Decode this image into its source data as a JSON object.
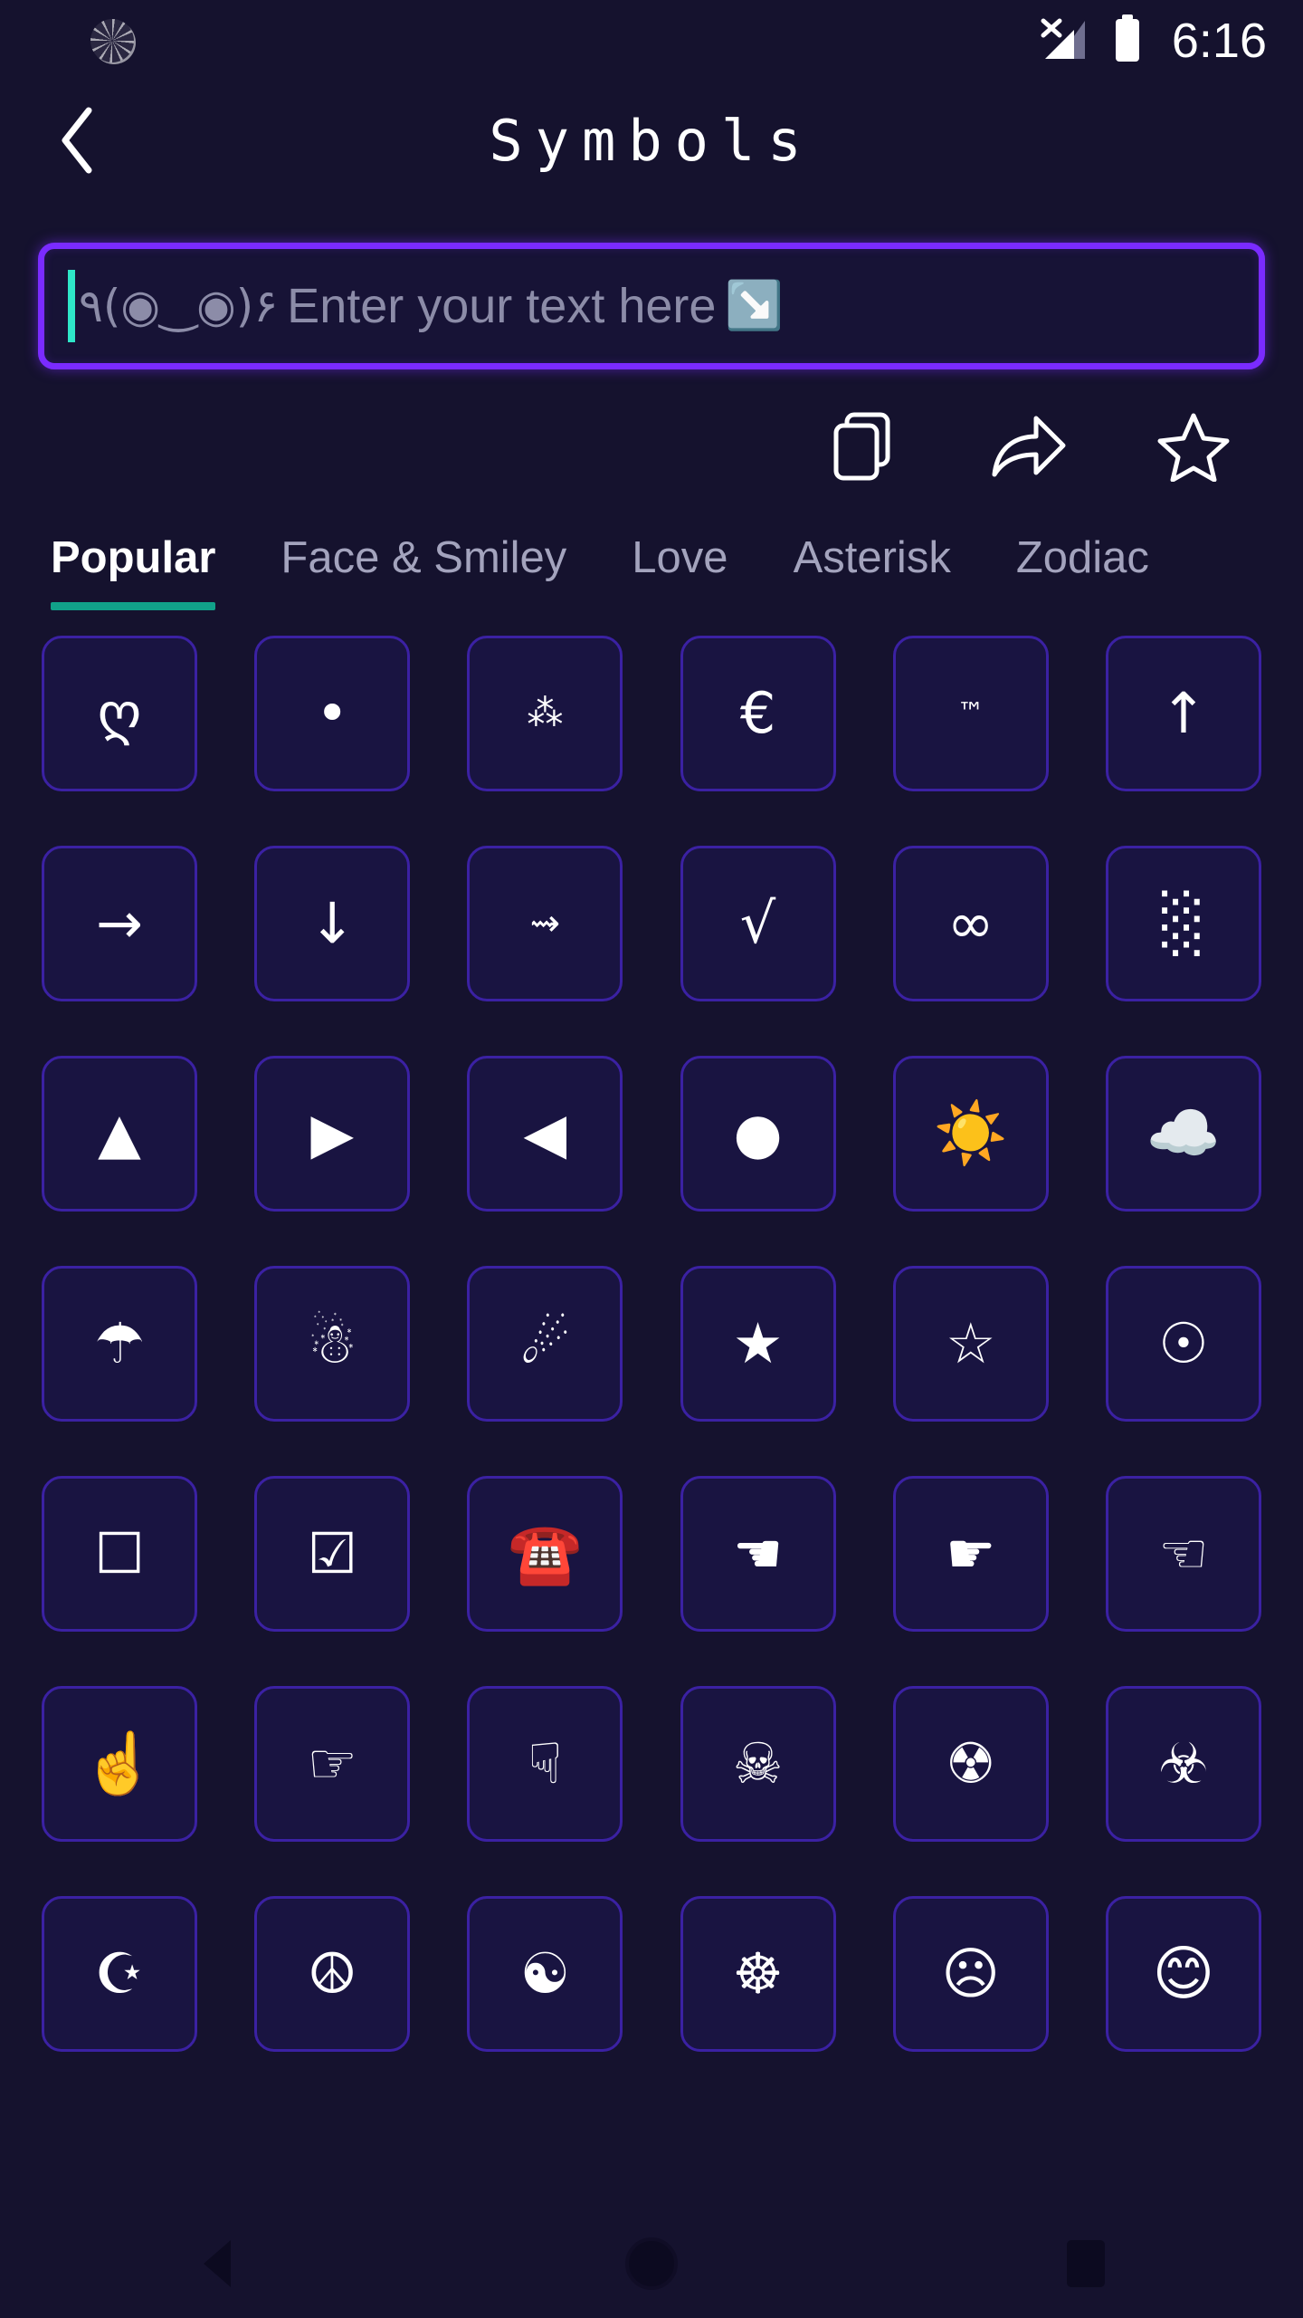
{
  "status_bar": {
    "time": "6:16",
    "icons": [
      "loading-spinner-icon",
      "signal-no-sim-icon",
      "battery-full-icon"
    ]
  },
  "header": {
    "back_label": "‹",
    "title": "Symbols"
  },
  "search": {
    "placeholder_kaomoji": "٩(◉‿◉)۶",
    "placeholder_text": "Enter your text here",
    "placeholder_emoji": "↘️",
    "value": ""
  },
  "actions": [
    {
      "name": "copy-button",
      "label": "Copy"
    },
    {
      "name": "share-button",
      "label": "Share"
    },
    {
      "name": "favorite-button",
      "label": "Favorite"
    }
  ],
  "tabs": {
    "active_index": 0,
    "items": [
      {
        "label": "Popular"
      },
      {
        "label": "Face & Smiley"
      },
      {
        "label": "Love"
      },
      {
        "label": "Asterisk"
      },
      {
        "label": "Zodiac"
      }
    ]
  },
  "grid": {
    "columns": 6,
    "cells": [
      {
        "char": "ღ",
        "name": "georgian-heart-symbol",
        "size": "normal"
      },
      {
        "char": "•",
        "name": "bullet-symbol",
        "size": "normal"
      },
      {
        "char": "⁂",
        "name": "asterism-symbol",
        "size": "small"
      },
      {
        "char": "€",
        "name": "euro-sign-symbol",
        "size": "normal"
      },
      {
        "char": "™",
        "name": "trademark-symbol",
        "size": "tiny"
      },
      {
        "char": "↑",
        "name": "up-arrow-symbol",
        "size": "normal"
      },
      {
        "char": "→",
        "name": "right-arrow-symbol",
        "size": "normal"
      },
      {
        "char": "↓",
        "name": "down-arrow-symbol",
        "size": "normal"
      },
      {
        "char": "⇝",
        "name": "squiggly-right-arrow-symbol",
        "size": "small"
      },
      {
        "char": "√",
        "name": "square-root-symbol",
        "size": "normal"
      },
      {
        "char": "∞",
        "name": "infinity-symbol",
        "size": "normal"
      },
      {
        "char": "░",
        "name": "light-shade-block-symbol",
        "size": "normal"
      },
      {
        "char": "▲",
        "name": "up-triangle-symbol",
        "size": "normal"
      },
      {
        "char": "▶",
        "name": "right-triangle-symbol",
        "size": "normal"
      },
      {
        "char": "◀",
        "name": "left-triangle-symbol",
        "size": "normal"
      },
      {
        "char": "●",
        "name": "filled-circle-symbol",
        "size": "normal"
      },
      {
        "char": "☀️",
        "name": "sun-emoji",
        "size": "emoji"
      },
      {
        "char": "☁️",
        "name": "cloud-emoji",
        "size": "emoji"
      },
      {
        "char": "☂",
        "name": "umbrella-symbol",
        "size": "normal"
      },
      {
        "char": "☃",
        "name": "snowman-symbol",
        "size": "normal"
      },
      {
        "char": "☄",
        "name": "comet-symbol",
        "size": "normal"
      },
      {
        "char": "★",
        "name": "filled-star-symbol",
        "size": "normal"
      },
      {
        "char": "☆",
        "name": "outline-star-symbol",
        "size": "normal"
      },
      {
        "char": "☉",
        "name": "sun-circled-dot-symbol",
        "size": "normal"
      },
      {
        "char": "☐",
        "name": "empty-checkbox-symbol",
        "size": "normal"
      },
      {
        "char": "☑",
        "name": "checked-checkbox-symbol",
        "size": "normal"
      },
      {
        "char": "☎️",
        "name": "telephone-emoji",
        "size": "emoji"
      },
      {
        "char": "☚",
        "name": "black-left-pointing-hand-symbol",
        "size": "normal"
      },
      {
        "char": "☛",
        "name": "black-right-pointing-hand-symbol",
        "size": "normal"
      },
      {
        "char": "☜",
        "name": "white-left-pointing-index-symbol",
        "size": "normal"
      },
      {
        "char": "☝️",
        "name": "index-pointing-up-emoji",
        "size": "emoji"
      },
      {
        "char": "☞",
        "name": "white-right-pointing-index-symbol",
        "size": "normal"
      },
      {
        "char": "☟",
        "name": "white-down-pointing-index-symbol",
        "size": "normal"
      },
      {
        "char": "☠",
        "name": "skull-and-crossbones-symbol",
        "size": "normal"
      },
      {
        "char": "☢",
        "name": "radioactive-symbol",
        "size": "normal"
      },
      {
        "char": "☣",
        "name": "biohazard-symbol",
        "size": "normal"
      },
      {
        "char": "☪",
        "name": "star-and-crescent-symbol",
        "size": "normal"
      },
      {
        "char": "☮",
        "name": "peace-symbol",
        "size": "normal"
      },
      {
        "char": "☯",
        "name": "yin-yang-symbol",
        "size": "normal"
      },
      {
        "char": "☸",
        "name": "wheel-of-dharma-symbol",
        "size": "normal"
      },
      {
        "char": "☹",
        "name": "frowning-face-symbol",
        "size": "normal"
      },
      {
        "char": "😊",
        "name": "smiling-face-emoji",
        "size": "emoji"
      }
    ]
  },
  "nav_bar": {
    "items": [
      {
        "name": "nav-back-button"
      },
      {
        "name": "nav-home-button"
      },
      {
        "name": "nav-recents-button"
      }
    ]
  },
  "colors": {
    "background": "#15122e",
    "cell_border": "#3b21a3",
    "input_border": "#7a2bff",
    "caret": "#2ee6c8",
    "tab_active_underline": "#11a189",
    "text_primary": "#ffffff",
    "text_muted": "#a3a3bd"
  }
}
